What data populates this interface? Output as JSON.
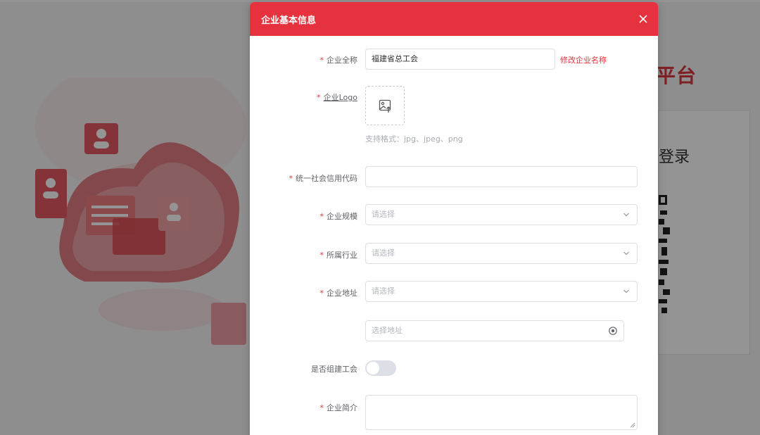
{
  "background": {
    "platform_title": "平台",
    "login_title": "登录"
  },
  "dialog": {
    "title": "企业基本信息",
    "close_icon": "close-icon"
  },
  "form": {
    "company_name": {
      "label": "企业全称",
      "value": "福建省总工会",
      "edit_link": "修改企业名称"
    },
    "company_logo": {
      "label": "企业Logo",
      "upload_icon": "image-upload-icon",
      "tip": "支持格式：jpg、jpeg、png"
    },
    "credit_code": {
      "label": "统一社会信用代码",
      "value": ""
    },
    "company_size": {
      "label": "企业规模",
      "placeholder": "请选择"
    },
    "industry": {
      "label": "所属行业",
      "placeholder": "请选择"
    },
    "company_address": {
      "label": "企业地址",
      "placeholder": "请选择"
    },
    "address_detail": {
      "placeholder": "选择地址",
      "icon": "location-icon"
    },
    "has_union": {
      "label": "是否组建工会",
      "value": false
    },
    "company_intro": {
      "label": "企业简介",
      "value": ""
    }
  },
  "colors": {
    "brand_red": "#e5323e",
    "required_star": "#e5323e"
  }
}
